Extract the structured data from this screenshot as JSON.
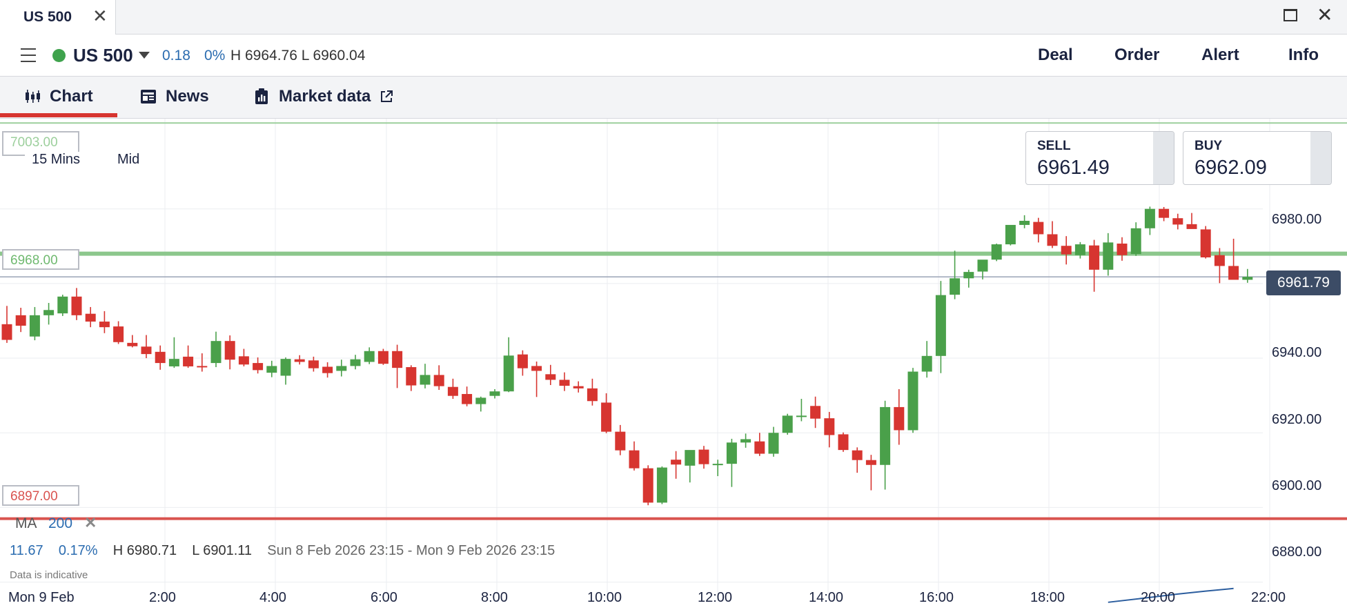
{
  "tab": {
    "title": "US 500"
  },
  "header": {
    "instrument": "US 500",
    "change_abs": "0.18",
    "change_pct": "0%",
    "high_low": "H 6964.76 L 6960.04",
    "buttons": [
      "Deal",
      "Order",
      "Alert",
      "Info"
    ]
  },
  "subtabs": [
    {
      "label": "Chart",
      "icon": "candlestick-icon"
    },
    {
      "label": "News",
      "icon": "newspaper-icon"
    },
    {
      "label": "Market data",
      "icon": "clipboard-icon"
    }
  ],
  "prices": {
    "sell_label": "SELL",
    "sell": "6961.49",
    "buy_label": "BUY",
    "buy": "6962.09",
    "current_tag": "6961.79"
  },
  "controls": {
    "timeframe": "15 Mins",
    "price_type": "Mid"
  },
  "chart_data": {
    "type": "candlestick",
    "x_tick_labels": [
      "2:00",
      "4:00",
      "6:00",
      "8:00",
      "10:00",
      "12:00",
      "14:00",
      "16:00",
      "18:00",
      "20:00",
      "22:00"
    ],
    "y_tick_labels": [
      "6980.00",
      "6940.00",
      "6920.00",
      "6900.00",
      "6880.00"
    ],
    "ylim": [
      6874.75,
      7004.9
    ],
    "date_label": "Mon 9 Feb",
    "level_lines": [
      {
        "label": "7003.00",
        "value": 7003.0,
        "color": "#9ccf9c"
      },
      {
        "label": "6968.00",
        "value": 6968.0,
        "color": "#8cc78c"
      },
      {
        "label": "6897.00",
        "value": 6897.0,
        "color": "#d9534f"
      }
    ],
    "current_price": 6961.79,
    "colors": {
      "up": "#4aa04a",
      "down": "#d73530"
    },
    "candles": [
      [
        6949.1,
        6954.0,
        6944.1,
        6944.9
      ],
      [
        6951.5,
        6953.5,
        6947.0,
        6948.7
      ],
      [
        6945.8,
        6953.7,
        6944.8,
        6951.5
      ],
      [
        6951.5,
        6954.8,
        6949.0,
        6952.9
      ],
      [
        6952.0,
        6957.0,
        6951.3,
        6956.5
      ],
      [
        6956.5,
        6958.8,
        6950.2,
        6951.5
      ],
      [
        6951.9,
        6953.7,
        6948.3,
        6949.8
      ],
      [
        6949.8,
        6952.6,
        6946.7,
        6948.3
      ],
      [
        6948.5,
        6949.9,
        6943.8,
        6944.3
      ],
      [
        6944.1,
        6946.2,
        6942.9,
        6943.2
      ],
      [
        6943.1,
        6946.2,
        6940.0,
        6941.1
      ],
      [
        6941.7,
        6943.4,
        6936.9,
        6938.7
      ],
      [
        6937.8,
        6945.6,
        6937.4,
        6939.8
      ],
      [
        6940.4,
        6943.4,
        6937.4,
        6937.8
      ],
      [
        6937.9,
        6941.3,
        6936.4,
        6937.6
      ],
      [
        6938.7,
        6947.1,
        6937.6,
        6944.6
      ],
      [
        6944.6,
        6946.1,
        6937.0,
        6939.6
      ],
      [
        6940.5,
        6942.5,
        6937.8,
        6938.3
      ],
      [
        6938.7,
        6940.2,
        6935.9,
        6936.8
      ],
      [
        6936.1,
        6939.3,
        6934.9,
        6937.9
      ],
      [
        6935.3,
        6940.2,
        6932.9,
        6939.8
      ],
      [
        6939.7,
        6940.8,
        6938.3,
        6939.0
      ],
      [
        6939.4,
        6940.4,
        6936.4,
        6937.3
      ],
      [
        6937.7,
        6938.9,
        6934.8,
        6936.0
      ],
      [
        6936.6,
        6939.6,
        6935.1,
        6937.9
      ],
      [
        6937.9,
        6940.9,
        6937.0,
        6939.7
      ],
      [
        6939.0,
        6942.9,
        6938.4,
        6941.9
      ],
      [
        6941.9,
        6942.5,
        6938.2,
        6938.5
      ],
      [
        6941.9,
        6943.6,
        6932.0,
        6937.4
      ],
      [
        6937.6,
        6938.1,
        6931.2,
        6932.7
      ],
      [
        6932.9,
        6938.5,
        6931.9,
        6935.5
      ],
      [
        6935.5,
        6938.1,
        6931.5,
        6932.5
      ],
      [
        6932.3,
        6934.5,
        6929.1,
        6929.9
      ],
      [
        6930.4,
        6932.4,
        6927.1,
        6927.7
      ],
      [
        6927.7,
        6929.7,
        6925.7,
        6929.4
      ],
      [
        6929.9,
        6931.7,
        6929.2,
        6931.1
      ],
      [
        6931.1,
        6945.6,
        6930.9,
        6940.7
      ],
      [
        6941.0,
        6942.1,
        6935.3,
        6937.3
      ],
      [
        6937.9,
        6939.1,
        6929.6,
        6936.6
      ],
      [
        6935.7,
        6938.2,
        6932.8,
        6934.2
      ],
      [
        6934.2,
        6936.2,
        6931.2,
        6932.6
      ],
      [
        6932.5,
        6933.8,
        6930.8,
        6931.9
      ],
      [
        6931.9,
        6934.5,
        6927.3,
        6928.5
      ],
      [
        6928.1,
        6930.6,
        6919.9,
        6920.3
      ],
      [
        6920.3,
        6922.1,
        6914.0,
        6915.3
      ],
      [
        6915.3,
        6917.7,
        6909.9,
        6910.5
      ],
      [
        6910.5,
        6911.3,
        6900.6,
        6901.3
      ],
      [
        6901.3,
        6911.0,
        6900.9,
        6910.7
      ],
      [
        6912.8,
        6915.1,
        6907.7,
        6911.5
      ],
      [
        6911.2,
        6915.2,
        6906.7,
        6915.4
      ],
      [
        6915.5,
        6916.5,
        6910.4,
        6911.6
      ],
      [
        6911.4,
        6912.8,
        6908.4,
        6911.7
      ],
      [
        6911.7,
        6918.4,
        6905.5,
        6917.4
      ],
      [
        6917.4,
        6919.8,
        6916.0,
        6918.3
      ],
      [
        6917.7,
        6920.0,
        6913.8,
        6914.4
      ],
      [
        6914.4,
        6921.6,
        6913.6,
        6920.0
      ],
      [
        6920.0,
        6925.1,
        6919.5,
        6924.6
      ],
      [
        6924.6,
        6929.1,
        6923.1,
        6924.6
      ],
      [
        6927.2,
        6929.7,
        6921.3,
        6923.8
      ],
      [
        6923.9,
        6925.6,
        6916.1,
        6919.4
      ],
      [
        6919.6,
        6920.1,
        6914.9,
        6915.4
      ],
      [
        6915.3,
        6916.1,
        6909.3,
        6912.7
      ],
      [
        6912.7,
        6914.1,
        6904.6,
        6911.4
      ],
      [
        6911.4,
        6928.6,
        6904.8,
        6926.9
      ],
      [
        6926.9,
        6931.7,
        6916.8,
        6920.7
      ],
      [
        6920.7,
        6937.4,
        6920.0,
        6936.4
      ],
      [
        6936.4,
        6944.6,
        6934.8,
        6940.6
      ],
      [
        6940.6,
        6960.7,
        6936.0,
        6956.9
      ],
      [
        6957.0,
        6968.8,
        6955.8,
        6961.4
      ],
      [
        6961.4,
        6963.7,
        6958.9,
        6963.1
      ],
      [
        6963.2,
        6965.7,
        6961.1,
        6966.4
      ],
      [
        6966.4,
        6970.7,
        6966.0,
        6970.5
      ],
      [
        6970.5,
        6975.5,
        6970.2,
        6975.7
      ],
      [
        6975.7,
        6978.3,
        6974.8,
        6976.8
      ],
      [
        6976.5,
        6977.6,
        6971.0,
        6973.2
      ],
      [
        6973.2,
        6976.7,
        6969.5,
        6970.1
      ],
      [
        6970.1,
        6972.7,
        6965.1,
        6967.8
      ],
      [
        6967.6,
        6971.1,
        6966.7,
        6970.5
      ],
      [
        6970.2,
        6971.7,
        6957.8,
        6963.7
      ],
      [
        6963.7,
        6973.5,
        6962.1,
        6971.0
      ],
      [
        6970.7,
        6972.4,
        6966.1,
        6967.6
      ],
      [
        6967.9,
        6976.4,
        6967.4,
        6974.8
      ],
      [
        6974.8,
        6980.6,
        6973.0,
        6980.0
      ],
      [
        6980.0,
        6980.5,
        6976.7,
        6977.6
      ],
      [
        6977.5,
        6978.7,
        6974.5,
        6975.8
      ],
      [
        6975.9,
        6978.9,
        6974.8,
        6974.6
      ],
      [
        6974.5,
        6975.4,
        6966.7,
        6967.0
      ],
      [
        6967.6,
        6969.5,
        6960.1,
        6964.7
      ],
      [
        6964.7,
        6972.0,
        6961.5,
        6961.0
      ],
      [
        6961.0,
        6963.9,
        6960.2,
        6961.8
      ]
    ],
    "ma": {
      "label": "MA",
      "period": "200",
      "color": "#2b5d9e",
      "points": [
        [
          79,
          6874.6
        ],
        [
          82,
          6875.9
        ],
        [
          84,
          6876.8
        ],
        [
          86,
          6877.6
        ],
        [
          88,
          6878.3
        ]
      ]
    },
    "stats": {
      "change": "11.67",
      "change_pct": "0.17%",
      "high": "H 6980.71",
      "low": "L 6901.11",
      "range": "Sun 8 Feb 2026 23:15 - Mon 9 Feb 2026 23:15"
    },
    "disclaimer": "Data is indicative"
  }
}
